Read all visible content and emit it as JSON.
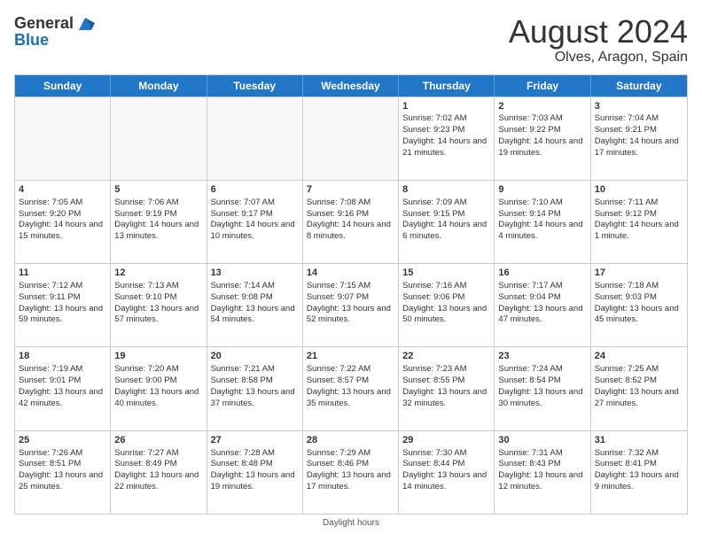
{
  "logo": {
    "text_general": "General",
    "text_blue": "Blue"
  },
  "title": {
    "month": "August 2024",
    "location": "Olves, Aragon, Spain"
  },
  "days_of_week": [
    "Sunday",
    "Monday",
    "Tuesday",
    "Wednesday",
    "Thursday",
    "Friday",
    "Saturday"
  ],
  "footer": {
    "daylight_label": "Daylight hours"
  },
  "weeks": [
    [
      {
        "day": "",
        "info": ""
      },
      {
        "day": "",
        "info": ""
      },
      {
        "day": "",
        "info": ""
      },
      {
        "day": "",
        "info": ""
      },
      {
        "day": "1",
        "sun": "Sunrise: 7:02 AM",
        "set": "Sunset: 9:23 PM",
        "dl": "Daylight: 14 hours and 21 minutes."
      },
      {
        "day": "2",
        "sun": "Sunrise: 7:03 AM",
        "set": "Sunset: 9:22 PM",
        "dl": "Daylight: 14 hours and 19 minutes."
      },
      {
        "day": "3",
        "sun": "Sunrise: 7:04 AM",
        "set": "Sunset: 9:21 PM",
        "dl": "Daylight: 14 hours and 17 minutes."
      }
    ],
    [
      {
        "day": "4",
        "sun": "Sunrise: 7:05 AM",
        "set": "Sunset: 9:20 PM",
        "dl": "Daylight: 14 hours and 15 minutes."
      },
      {
        "day": "5",
        "sun": "Sunrise: 7:06 AM",
        "set": "Sunset: 9:19 PM",
        "dl": "Daylight: 14 hours and 13 minutes."
      },
      {
        "day": "6",
        "sun": "Sunrise: 7:07 AM",
        "set": "Sunset: 9:17 PM",
        "dl": "Daylight: 14 hours and 10 minutes."
      },
      {
        "day": "7",
        "sun": "Sunrise: 7:08 AM",
        "set": "Sunset: 9:16 PM",
        "dl": "Daylight: 14 hours and 8 minutes."
      },
      {
        "day": "8",
        "sun": "Sunrise: 7:09 AM",
        "set": "Sunset: 9:15 PM",
        "dl": "Daylight: 14 hours and 6 minutes."
      },
      {
        "day": "9",
        "sun": "Sunrise: 7:10 AM",
        "set": "Sunset: 9:14 PM",
        "dl": "Daylight: 14 hours and 4 minutes."
      },
      {
        "day": "10",
        "sun": "Sunrise: 7:11 AM",
        "set": "Sunset: 9:12 PM",
        "dl": "Daylight: 14 hours and 1 minute."
      }
    ],
    [
      {
        "day": "11",
        "sun": "Sunrise: 7:12 AM",
        "set": "Sunset: 9:11 PM",
        "dl": "Daylight: 13 hours and 59 minutes."
      },
      {
        "day": "12",
        "sun": "Sunrise: 7:13 AM",
        "set": "Sunset: 9:10 PM",
        "dl": "Daylight: 13 hours and 57 minutes."
      },
      {
        "day": "13",
        "sun": "Sunrise: 7:14 AM",
        "set": "Sunset: 9:08 PM",
        "dl": "Daylight: 13 hours and 54 minutes."
      },
      {
        "day": "14",
        "sun": "Sunrise: 7:15 AM",
        "set": "Sunset: 9:07 PM",
        "dl": "Daylight: 13 hours and 52 minutes."
      },
      {
        "day": "15",
        "sun": "Sunrise: 7:16 AM",
        "set": "Sunset: 9:06 PM",
        "dl": "Daylight: 13 hours and 50 minutes."
      },
      {
        "day": "16",
        "sun": "Sunrise: 7:17 AM",
        "set": "Sunset: 9:04 PM",
        "dl": "Daylight: 13 hours and 47 minutes."
      },
      {
        "day": "17",
        "sun": "Sunrise: 7:18 AM",
        "set": "Sunset: 9:03 PM",
        "dl": "Daylight: 13 hours and 45 minutes."
      }
    ],
    [
      {
        "day": "18",
        "sun": "Sunrise: 7:19 AM",
        "set": "Sunset: 9:01 PM",
        "dl": "Daylight: 13 hours and 42 minutes."
      },
      {
        "day": "19",
        "sun": "Sunrise: 7:20 AM",
        "set": "Sunset: 9:00 PM",
        "dl": "Daylight: 13 hours and 40 minutes."
      },
      {
        "day": "20",
        "sun": "Sunrise: 7:21 AM",
        "set": "Sunset: 8:58 PM",
        "dl": "Daylight: 13 hours and 37 minutes."
      },
      {
        "day": "21",
        "sun": "Sunrise: 7:22 AM",
        "set": "Sunset: 8:57 PM",
        "dl": "Daylight: 13 hours and 35 minutes."
      },
      {
        "day": "22",
        "sun": "Sunrise: 7:23 AM",
        "set": "Sunset: 8:55 PM",
        "dl": "Daylight: 13 hours and 32 minutes."
      },
      {
        "day": "23",
        "sun": "Sunrise: 7:24 AM",
        "set": "Sunset: 8:54 PM",
        "dl": "Daylight: 13 hours and 30 minutes."
      },
      {
        "day": "24",
        "sun": "Sunrise: 7:25 AM",
        "set": "Sunset: 8:52 PM",
        "dl": "Daylight: 13 hours and 27 minutes."
      }
    ],
    [
      {
        "day": "25",
        "sun": "Sunrise: 7:26 AM",
        "set": "Sunset: 8:51 PM",
        "dl": "Daylight: 13 hours and 25 minutes."
      },
      {
        "day": "26",
        "sun": "Sunrise: 7:27 AM",
        "set": "Sunset: 8:49 PM",
        "dl": "Daylight: 13 hours and 22 minutes."
      },
      {
        "day": "27",
        "sun": "Sunrise: 7:28 AM",
        "set": "Sunset: 8:48 PM",
        "dl": "Daylight: 13 hours and 19 minutes."
      },
      {
        "day": "28",
        "sun": "Sunrise: 7:29 AM",
        "set": "Sunset: 8:46 PM",
        "dl": "Daylight: 13 hours and 17 minutes."
      },
      {
        "day": "29",
        "sun": "Sunrise: 7:30 AM",
        "set": "Sunset: 8:44 PM",
        "dl": "Daylight: 13 hours and 14 minutes."
      },
      {
        "day": "30",
        "sun": "Sunrise: 7:31 AM",
        "set": "Sunset: 8:43 PM",
        "dl": "Daylight: 13 hours and 12 minutes."
      },
      {
        "day": "31",
        "sun": "Sunrise: 7:32 AM",
        "set": "Sunset: 8:41 PM",
        "dl": "Daylight: 13 hours and 9 minutes."
      }
    ]
  ]
}
